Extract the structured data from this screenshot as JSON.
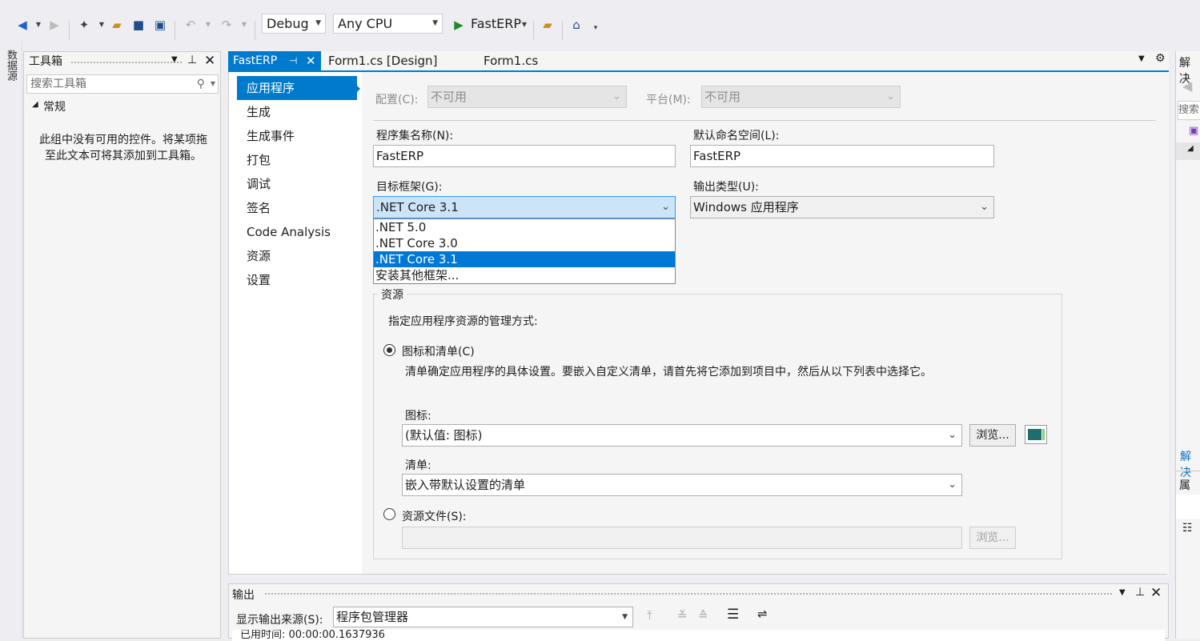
{
  "toolbar": {
    "config_value": "Debug",
    "platform_value": "Any CPU",
    "run_label": "FastERP"
  },
  "rail": {
    "label": "数据源"
  },
  "toolbox": {
    "title": "工具箱",
    "search_placeholder": "搜索工具箱",
    "group": "常规",
    "empty_message": "此组中没有可用的控件。将某项拖至此文本可将其添加到工具箱。"
  },
  "tabs": [
    {
      "label": "FastERP"
    },
    {
      "label": "Form1.cs [Design]"
    },
    {
      "label": "Form1.cs"
    }
  ],
  "nav": [
    {
      "label": "应用程序"
    },
    {
      "label": "生成"
    },
    {
      "label": "生成事件"
    },
    {
      "label": "打包"
    },
    {
      "label": "调试"
    },
    {
      "label": "签名"
    },
    {
      "label": "Code Analysis"
    },
    {
      "label": "资源"
    },
    {
      "label": "设置"
    }
  ],
  "app": {
    "config_label": "配置(C):",
    "config_value": "不可用",
    "platform_label": "平台(M):",
    "platform_value": "不可用",
    "assembly_label": "程序集名称(N):",
    "assembly_value": "FastERP",
    "namespace_label": "默认命名空间(L):",
    "namespace_value": "FastERP",
    "framework_label": "目标框架(G):",
    "framework_value": ".NET Core 3.1",
    "framework_options": [
      ".NET 5.0",
      ".NET Core 3.0",
      ".NET Core 3.1",
      "安装其他框架..."
    ],
    "output_label": "输出类型(U):",
    "output_value": "Windows 应用程序",
    "resources": {
      "legend": "资源",
      "desc": "指定应用程序资源的管理方式:",
      "radio_icon_manifest": "图标和清单(C)",
      "manifest_desc": "清单确定应用程序的具体设置。要嵌入自定义清单，请首先将它添加到项目中，然后从以下列表中选择它。",
      "icon_label": "图标:",
      "icon_value": "(默认值: 图标)",
      "browse_label": "浏览...",
      "manifest_label": "清单:",
      "manifest_value": "嵌入带默认设置的清单",
      "radio_resource_file": "资源文件(S):",
      "resource_browse_label": "浏览..."
    }
  },
  "right": {
    "solution_label": "解决",
    "search": "搜索",
    "solution_link": "解决",
    "props_label": "属性"
  },
  "output": {
    "title": "输出",
    "source_label": "显示输出来源(S):",
    "source_value": "程序包管理器",
    "log_line": "已用时间: 00:00:00.1637936"
  }
}
